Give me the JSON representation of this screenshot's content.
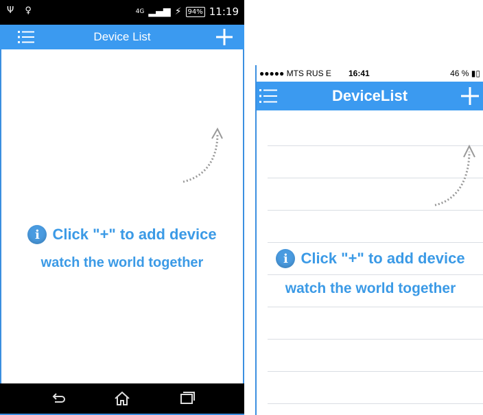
{
  "android": {
    "status": {
      "left_icons": "Ψ ♀",
      "network": "4G",
      "battery": "94%",
      "time": "11:19"
    },
    "nav": {
      "title": "Device List"
    },
    "hint": {
      "line1": "Click \"+\" to add device",
      "line2": "watch the world together"
    }
  },
  "ios": {
    "status": {
      "carrier": "●●●●● MTS RUS  E",
      "time": "16:41",
      "battery": "46 % ▮▯"
    },
    "nav": {
      "title": "DeviceList"
    },
    "hint": {
      "line1": "Click \"+\" to add device",
      "line2": "watch the world together"
    }
  },
  "colors": {
    "accent": "#3b9af0",
    "hint_text": "#3b9ae6",
    "frame": "#3b8fe0"
  },
  "icons": [
    "menu-icon",
    "plus-icon",
    "info-icon",
    "curved-arrow-icon",
    "back-icon",
    "home-icon",
    "recents-icon"
  ]
}
